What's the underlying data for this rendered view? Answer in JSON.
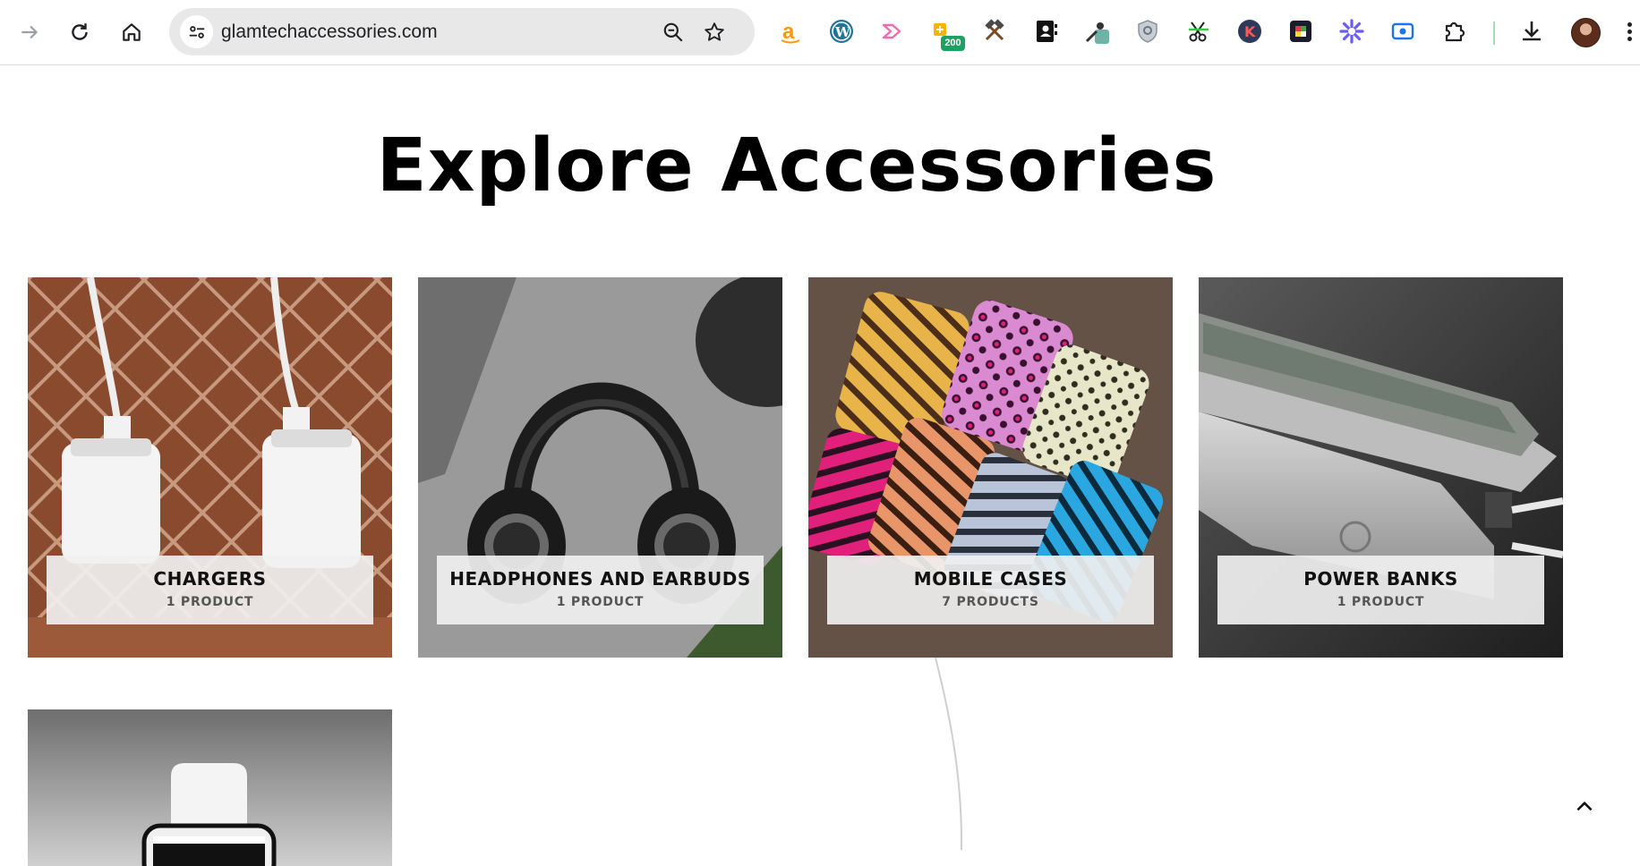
{
  "browser": {
    "url": "glamtechaccessories.com",
    "extension_badge": "200",
    "extensions": [
      "amazon-icon",
      "wordpress-icon",
      "play-flow-icon",
      "puzzle-plus-icon",
      "hammer-tools-icon",
      "contacts-book-icon",
      "eyedropper-icon",
      "shield-icon",
      "scissors-icon",
      "k-circle-icon",
      "color-tile-icon",
      "asterisk-flower-icon",
      "screen-record-icon",
      "extensions-puzzle-icon"
    ]
  },
  "page": {
    "title": "Explore Accessories"
  },
  "categories": [
    {
      "name": "CHARGERS",
      "count": "1 PRODUCT"
    },
    {
      "name": "HEADPHONES AND EARBUDS",
      "count": "1 PRODUCT"
    },
    {
      "name": "MOBILE CASES",
      "count": "7 PRODUCTS"
    },
    {
      "name": "POWER BANKS",
      "count": "1 PRODUCT"
    }
  ],
  "colors": {
    "accent_amazon": "#ff9900",
    "accent_wordpress": "#21759b",
    "label_bg": "#f0f0f0"
  }
}
